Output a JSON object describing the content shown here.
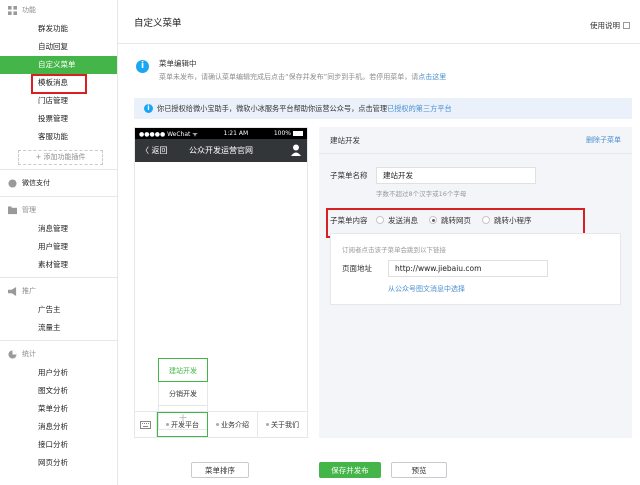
{
  "sidebar": {
    "sections": {
      "func": "功能",
      "pay": "微信支付",
      "manage": "管理",
      "promo": "推广",
      "stats": "统计"
    },
    "func_items": [
      "群发功能",
      "自动回复",
      "自定义菜单",
      "模板消息",
      "门店管理",
      "投票管理",
      "客服功能"
    ],
    "add_plugin": "+ 添加功能插件",
    "manage_items": [
      "消息管理",
      "用户管理",
      "素材管理"
    ],
    "promo_items": [
      "广告主",
      "流量主"
    ],
    "stats_items": [
      "用户分析",
      "图文分析",
      "菜单分析",
      "消息分析",
      "接口分析",
      "网页分析"
    ]
  },
  "topbar": {
    "title": "自定义菜单",
    "help": "使用说明"
  },
  "notice": {
    "title": "菜单编辑中",
    "desc": "菜单未发布，请确认菜单编辑完成后点击“保存并发布”同步到手机。若停用菜单，请",
    "link": "点击这里"
  },
  "info_bar": {
    "text": "你已授权给微小宝助手，微软小冰服务平台帮助你运营公众号，点击管理",
    "link": "已授权的第三方平台"
  },
  "phone": {
    "status_carrier": "●●●●● WeChat ᯤ",
    "status_time": "1:21 AM",
    "status_battery": "100%",
    "back": "〈 返回",
    "title": "公众开发运营官网",
    "submenu": [
      "建站开发",
      "分销开发",
      "+"
    ],
    "menus": [
      "开发平台",
      "业务介绍",
      "关于我们"
    ]
  },
  "editor": {
    "header": "建站开发",
    "delete": "删除子菜单",
    "name_label": "子菜单名称",
    "name_value": "建站开发",
    "name_hint": "字数不超过8个汉字或16个字母",
    "content_label": "子菜单内容",
    "options": [
      "发送消息",
      "跳转网页",
      "跳转小程序"
    ],
    "selected_option": "跳转网页",
    "url_sub": "订阅者点击该子菜单会跳到以下链接",
    "url_label": "页面地址",
    "url_value": "http://www.jiebaiu.com",
    "url_pick": "从公众号图文消息中选择"
  },
  "buttons": {
    "sort": "菜单排序",
    "save": "保存并发布",
    "preview": "预览"
  },
  "colors": {
    "accent": "#44b549",
    "highlight": "#d92020",
    "link": "#4a8fd0"
  }
}
